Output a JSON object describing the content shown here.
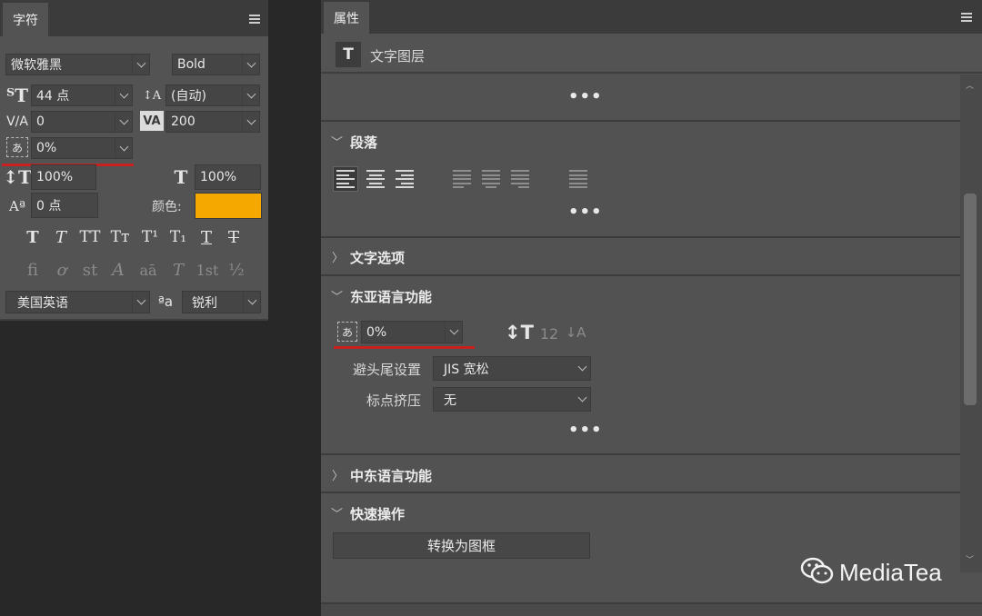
{
  "character_panel": {
    "tab": "字符",
    "font_family": "微软雅黑",
    "font_style": "Bold",
    "font_size": "44 点",
    "leading": "(自动)",
    "kerning": "0",
    "tracking": "200",
    "tsume": "0%",
    "vertical_scale": "100%",
    "horizontal_scale": "100%",
    "baseline_shift": "0 点",
    "color_label": "颜色:",
    "color_value": "#f5a800",
    "style_buttons": [
      "T",
      "T",
      "TT",
      "Tт",
      "T¹",
      "T₁",
      "T",
      "T"
    ],
    "opentype_buttons": [
      "fi",
      "ơ",
      "st",
      "A",
      "aā",
      "T",
      "1st",
      "½"
    ],
    "language": "美国英语",
    "aa_label": "ªa",
    "antialias": "锐利"
  },
  "properties_panel": {
    "tab": "属性",
    "layer_type": "文字图层",
    "sections": {
      "paragraph": "段落",
      "text_options": "文字选项",
      "east_asian": "东亚语言功能",
      "middle_eastern": "中东语言功能",
      "quick_actions": "快速操作"
    },
    "tsume": "0%",
    "kinsoku_label": "避头尾设置",
    "kinsoku_value": "JIS 宽松",
    "mojikumi_label": "标点挤压",
    "mojikumi_value": "无",
    "convert_button": "转换为图框",
    "more": "•••"
  },
  "watermark": "MediaTea",
  "colors": {
    "highlight_underline": "#c8201f",
    "text_color_swatch": "#f5a800"
  }
}
